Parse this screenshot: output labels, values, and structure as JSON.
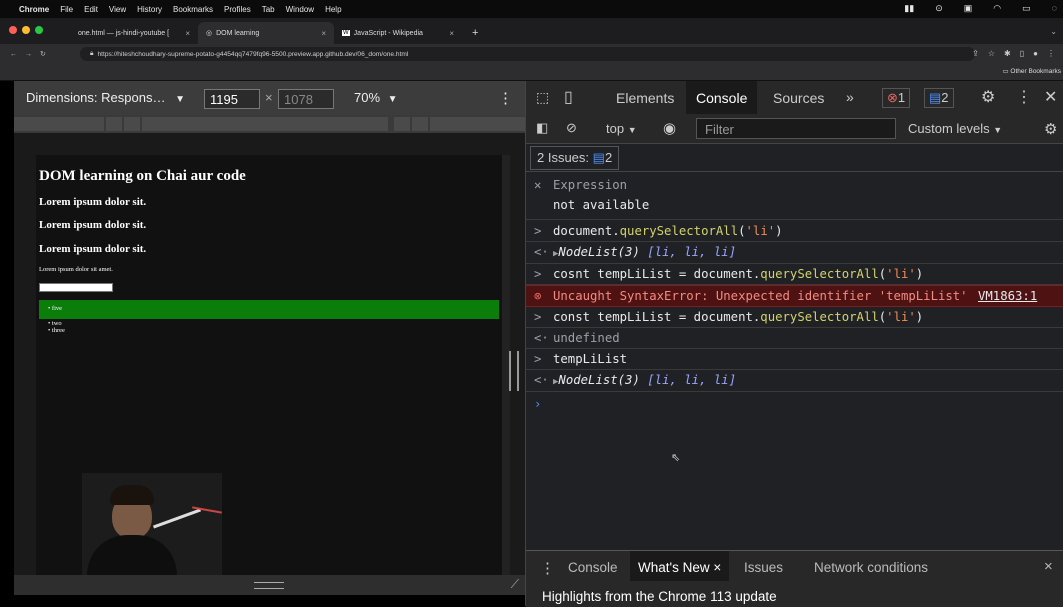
{
  "menubar": {
    "items": [
      "Chrome",
      "File",
      "Edit",
      "View",
      "History",
      "Bookmarks",
      "Profiles",
      "Tab",
      "Window",
      "Help"
    ]
  },
  "tabs": [
    {
      "title": "one.html — js-hindi-youtube [",
      "close": "×"
    },
    {
      "title": "DOM learning",
      "close": "×"
    },
    {
      "title": "JavaScript - Wikipedia",
      "close": "×"
    }
  ],
  "tabs_new": "+",
  "address": {
    "url": "https://hiteshchoudhary-supreme-potato-g4454qq7479fq96-5500.preview.app.github.dev/06_dom/one.html"
  },
  "bookmarks": {
    "other": "Other Bookmarks"
  },
  "device_toolbar": {
    "dimensions": "Dimensions: Respons…",
    "width": "1195",
    "times": "×",
    "height": "1078",
    "zoom": "70%"
  },
  "page": {
    "h1": "DOM learning on Chai aur code",
    "h2s": [
      "Lorem ipsum dolor sit.",
      "Lorem ipsum dolor sit.",
      "Lorem ipsum dolor sit."
    ],
    "para": "Lorem ipsum dolor sit amet.",
    "list": [
      "five",
      "two",
      "three"
    ],
    "highlight_color": "#0a7d0a"
  },
  "devtools": {
    "tabs": [
      "Elements",
      "Console",
      "Sources"
    ],
    "more": "»",
    "errors": "1",
    "messages": "2",
    "context": "top",
    "filter_placeholder": "Filter",
    "levels": "Custom levels",
    "issues_label": "2 Issues:",
    "issues_count": "2",
    "expression_label": "Expression",
    "expression_value": "not available",
    "lines": {
      "l1_a": "document.",
      "l1_fn": "querySelectorAll",
      "l1_b": "(",
      "l1_str": "'li'",
      "l1_c": ")",
      "r1_a": "NodeList(3) ",
      "r1_b": "[li, li, li]",
      "l2_a": "cosnt tempLiList = document.",
      "l2_fn": "querySelectorAll",
      "l2_b": "(",
      "l2_str": "'li'",
      "l2_c": ")",
      "err": "Uncaught SyntaxError: Unexpected identifier 'tempLiList'",
      "err_src": "VM1863:1",
      "l3_a": "const tempLiList = document.",
      "l3_fn": "querySelectorAll",
      "l3_b": "(",
      "l3_str": "'li'",
      "l3_c": ")",
      "r3": "undefined",
      "l4": "tempLiList",
      "r4_a": "NodeList(3) ",
      "r4_b": "[li, li, li]"
    },
    "drawer_tabs": [
      "Console",
      "What's New",
      "Issues",
      "Network conditions"
    ],
    "drawer_close": "×",
    "whats_new_close": "×",
    "drawer_text": "Highlights from the Chrome 113 update"
  }
}
